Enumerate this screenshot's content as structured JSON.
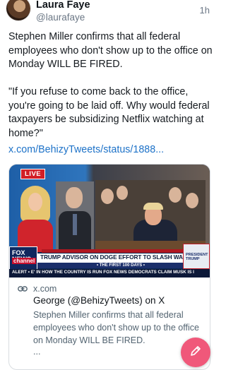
{
  "post": {
    "author_name": "Laura Faye",
    "author_handle": "@laurafaye",
    "time": "1h",
    "text": "Stephen Miller confirms that all federal employees who don't show up to the office on Monday WILL BE FIRED.\n\n\"If you refuse to come back to the office, you're going to be laid off. Why would federal taxpayers be subsidizing Netflix watching at home?\"",
    "link": "x.com/BehizyTweets/status/1888..."
  },
  "card": {
    "domain": "x.com",
    "title": "George (@BehizyTweets) on X",
    "description": "Stephen Miller confirms that all federal employees who don't show up to the office on Monday WILL BE FIRED.",
    "more": "...",
    "thumbnail": {
      "live_badge": "LIVE",
      "chyron": "TRUMP ADVISOR ON DOGE EFFORT TO SLASH WASTE",
      "chyron_sub": "• THE FIRST 100 DAYS •",
      "network_logo": "FOX NEWS",
      "network_logo_sub": "channel",
      "promo": "PRESIDENT TRUMP",
      "ticker": "ALERT • E' IN HOW THE COUNTRY IS RUN  FOX NEWS  DEMOCRATS CLAIM MUSK IS I"
    }
  },
  "icons": {
    "link_icon": "link-icon",
    "compose_icon": "pencil-icon"
  },
  "colors": {
    "link": "#1d72c8",
    "fab": "#f0587a",
    "live_red": "#d21f26"
  }
}
